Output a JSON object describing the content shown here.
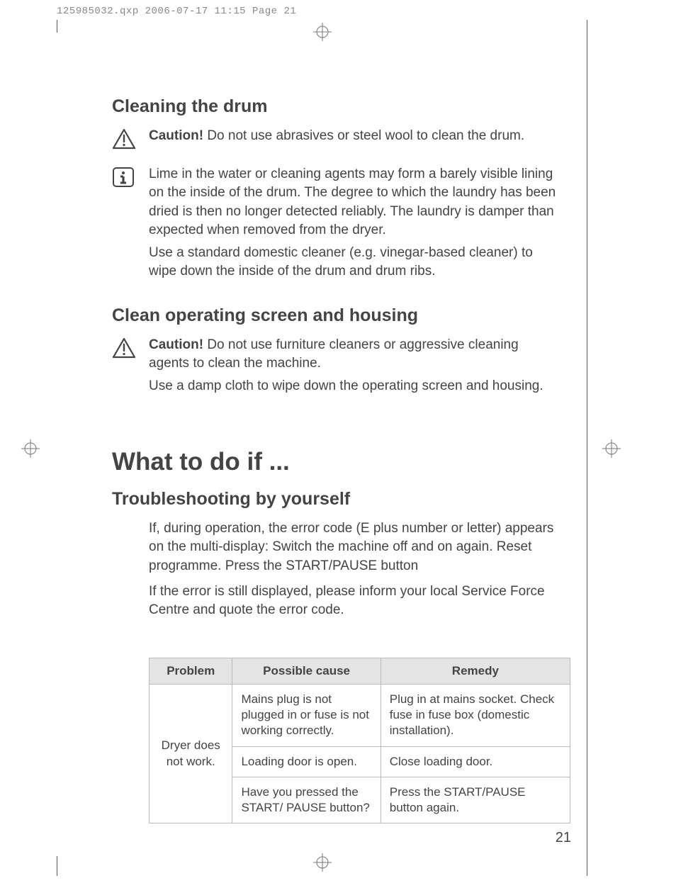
{
  "meta": {
    "line": "125985032.qxp  2006-07-17  11:15  Page 21"
  },
  "section1": {
    "heading": "Cleaning the drum",
    "caution_bold": "Caution!",
    "caution_text": " Do not use abrasives or steel wool to clean the drum.",
    "info1": "Lime in the water or cleaning agents may form a barely visible lining on the inside of the drum. The degree to which the laundry has been dried is then no longer detected reliably. The laundry is damper than expected when removed from the dryer.",
    "info2": "Use a standard domestic cleaner (e.g. vinegar-based cleaner) to wipe down the inside of the drum and drum ribs."
  },
  "section2": {
    "heading": "Clean operating screen and housing",
    "caution_bold": "Caution!",
    "caution_text": " Do not use furniture cleaners or aggressive cleaning agents to clean the machine.",
    "line2": "Use a damp cloth to wipe down the operating screen and housing."
  },
  "section3": {
    "heading": "What to do if ...",
    "subheading": "Troubleshooting by yourself",
    "p1": "If, during operation, the error code (E plus number or letter) appears on the multi-display: Switch the machine off and on again. Reset programme. Press the START/PAUSE button",
    "p2": "If the error is still displayed, please inform your local Service Force Centre and quote the error code."
  },
  "table": {
    "headers": {
      "c1": "Problem",
      "c2": "Possible cause",
      "c3": "Remedy"
    },
    "problem": "Dryer does not work.",
    "rows": [
      {
        "cause": "Mains plug is not plugged in or fuse is not working correctly.",
        "remedy": "Plug in at mains socket. Check fuse in fuse box (domestic installation)."
      },
      {
        "cause": "Loading door is open.",
        "remedy": "Close loading door."
      },
      {
        "cause": "Have you pressed the START/ PAUSE button?",
        "remedy": "Press the START/PAUSE button again."
      }
    ]
  },
  "page_number": "21"
}
